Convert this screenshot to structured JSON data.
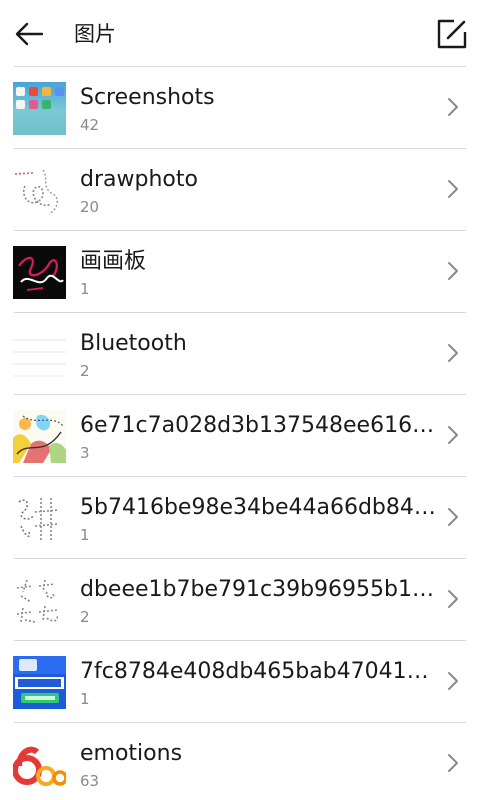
{
  "header": {
    "title": "图片",
    "back_icon": "arrow-left-icon",
    "edit_icon": "edit-icon"
  },
  "albums": [
    {
      "name": "Screenshots",
      "count": "42",
      "thumb": "screenshots-thumbnail"
    },
    {
      "name": "drawphoto",
      "count": "20",
      "thumb": "drawphoto-thumbnail"
    },
    {
      "name": "画画板",
      "count": "1",
      "thumb": "drawing-board-thumbnail"
    },
    {
      "name": "Bluetooth",
      "count": "2",
      "thumb": "bluetooth-thumbnail"
    },
    {
      "name": "6e71c7a028d3b137548ee6161…",
      "count": "3",
      "thumb": "colorful-doodle-thumbnail"
    },
    {
      "name": "5b7416be98e34be44a66db84f…",
      "count": "1",
      "thumb": "sketch-thumbnail"
    },
    {
      "name": "dbeee1b7be791c39b96955b16…",
      "count": "2",
      "thumb": "sketch-thumbnail"
    },
    {
      "name": "7fc8784e408db465bab47041df…",
      "count": "1",
      "thumb": "promo-image-thumbnail"
    },
    {
      "name": "emotions",
      "count": "63",
      "thumb": "emotions-thumbnail"
    }
  ],
  "colors": {
    "divider": "#d9d9d9",
    "secondary_text": "#8a8a8a",
    "chevron": "#8a8a8a"
  }
}
